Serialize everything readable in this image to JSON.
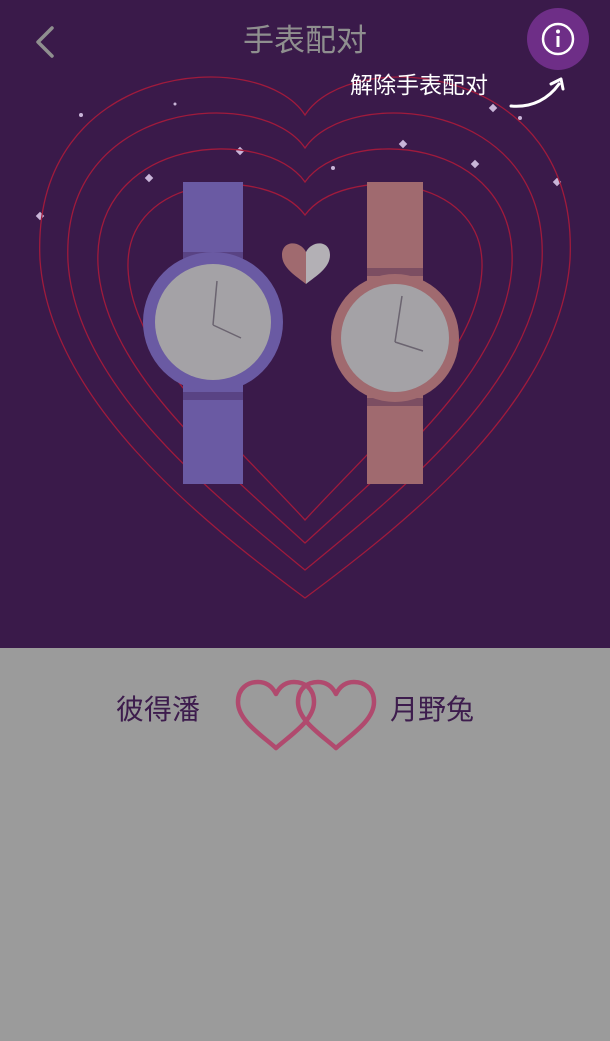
{
  "header": {
    "title": "手表配对",
    "back_icon": "chevron-left-icon",
    "info_icon": "info-icon",
    "unpair_label": "解除手表配对"
  },
  "pair": {
    "left_name": "彼得潘",
    "right_name": "月野兔",
    "link_icon": "double-heart-icon"
  },
  "colors": {
    "hero_background": "#3a1a4a",
    "bottom_background": "#9b9b9b",
    "accent": "#6e2e87",
    "heart_outline": "#a01a3c",
    "left_watch": "#6a5aa3",
    "right_watch": "#a06a6f",
    "names": "#3d1c4d"
  }
}
